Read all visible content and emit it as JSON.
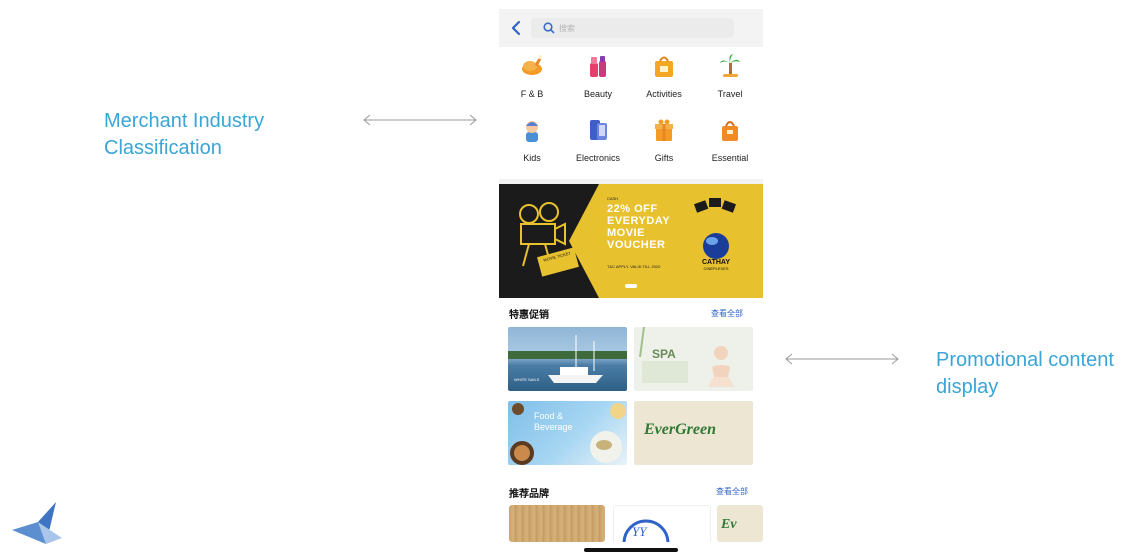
{
  "annotations": {
    "merchant": "Merchant Industry\nClassification",
    "promotional": "Promotional content\ndisplay"
  },
  "search": {
    "placeholder": "搜索"
  },
  "categories": [
    {
      "label": "F & B",
      "icon": "roast-chicken-icon"
    },
    {
      "label": "Beauty",
      "icon": "cosmetics-icon"
    },
    {
      "label": "Activities",
      "icon": "ticket-bag-icon"
    },
    {
      "label": "Travel",
      "icon": "palm-tree-icon"
    },
    {
      "label": "Kids",
      "icon": "kid-icon"
    },
    {
      "label": "Electronics",
      "icon": "phone-icon"
    },
    {
      "label": "Gifts",
      "icon": "gift-box-icon"
    },
    {
      "label": "Essential",
      "icon": "shopping-bag-icon"
    }
  ],
  "banner": {
    "small": "CASH",
    "headline": "22% OFF EVERYDAY MOVIE VOUCHER",
    "sub": "T&C APPLY. VALID TILL 2020",
    "ticket": "MOVIE TICKET",
    "brand": "CATHAY",
    "brand_sub": "CINEPLEXES"
  },
  "promo_section": {
    "title": "特惠促销",
    "more": "查看全部"
  },
  "promos": [
    {
      "name": "yacht-promo",
      "caption": "WHITE SAILS"
    },
    {
      "name": "spa-promo",
      "caption": "SPA"
    },
    {
      "name": "food-beverage-promo",
      "caption": "Food & Beverage"
    },
    {
      "name": "evergreen-promo",
      "caption": "EverGreen"
    }
  ],
  "brand_section": {
    "title": "推荐品牌",
    "more": "查看全部"
  },
  "brands": [
    {
      "name": "wood-brand"
    },
    {
      "name": "yy-brand",
      "caption": "YY"
    },
    {
      "name": "evergreen-brand",
      "caption": "Ev"
    }
  ],
  "colors": {
    "accent": "#3aa5d6",
    "banner": "#e8c12e",
    "link": "#2f63c7"
  }
}
